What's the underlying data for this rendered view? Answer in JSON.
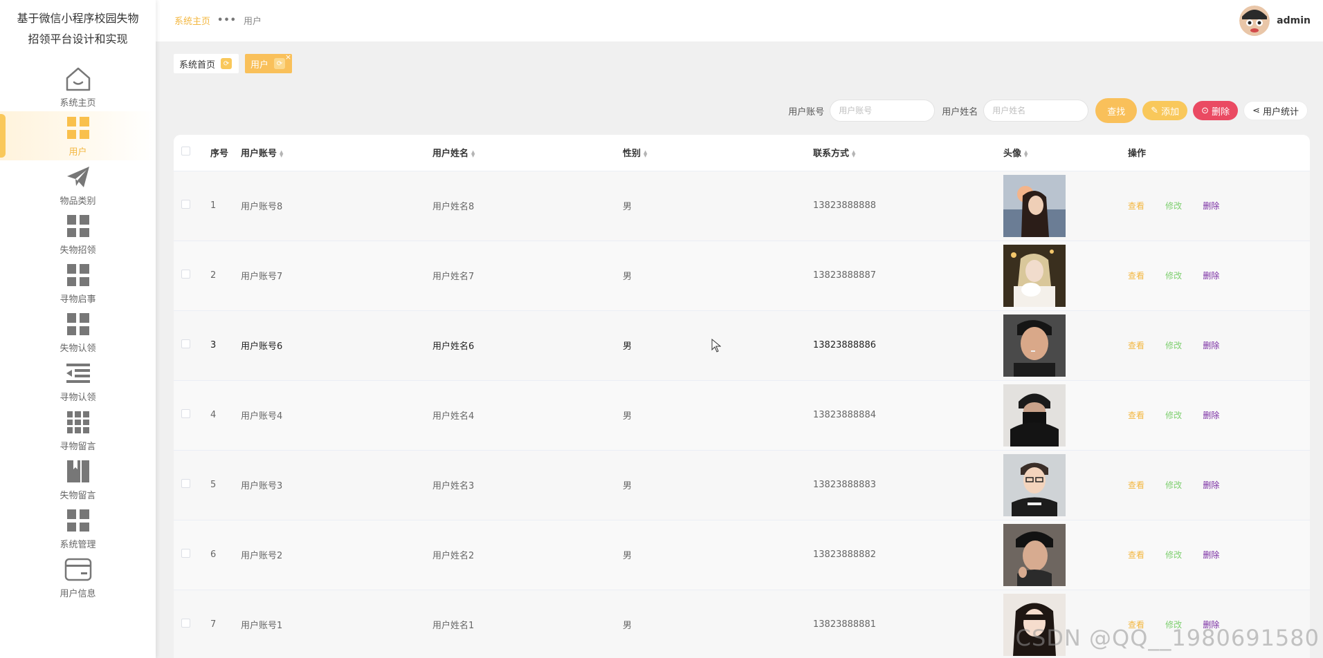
{
  "app": {
    "title_line1": "基于微信小程序校园失物",
    "title_line2": "招领平台设计和实现"
  },
  "sidebar": {
    "items": [
      {
        "label": "系统主页",
        "icon": "home-icon"
      },
      {
        "label": "用户",
        "icon": "grid-icon",
        "active": true
      },
      {
        "label": "物品类别",
        "icon": "paper-plane-icon"
      },
      {
        "label": "失物招领",
        "icon": "grid-icon"
      },
      {
        "label": "寻物启事",
        "icon": "grid-icon"
      },
      {
        "label": "失物认领",
        "icon": "grid-icon"
      },
      {
        "label": "寻物认领",
        "icon": "list-indent-icon"
      },
      {
        "label": "寻物留言",
        "icon": "grid9-icon"
      },
      {
        "label": "失物留言",
        "icon": "book-icon"
      },
      {
        "label": "系统管理",
        "icon": "grid-icon"
      },
      {
        "label": "用户信息",
        "icon": "card-icon"
      }
    ]
  },
  "header": {
    "breadcrumb_home": "系统主页",
    "breadcrumb_sep": "•••",
    "breadcrumb_current": "用户",
    "username": "admin"
  },
  "tags": {
    "home": "系统首页",
    "current": "用户",
    "close": "×"
  },
  "search": {
    "account_label": "用户账号",
    "account_placeholder": "用户账号",
    "name_label": "用户姓名",
    "name_placeholder": "用户姓名",
    "search_btn": "查找",
    "add_btn": "添加",
    "delete_btn": "删除",
    "stats_btn": "用户统计"
  },
  "table": {
    "headers": {
      "index": "序号",
      "account": "用户账号",
      "name": "用户姓名",
      "gender": "性别",
      "phone": "联系方式",
      "avatar": "头像",
      "actions": "操作"
    },
    "action_labels": {
      "view": "查看",
      "edit": "修改",
      "delete": "删除"
    },
    "rows": [
      {
        "index": "1",
        "account": "用户账号8",
        "name": "用户姓名8",
        "gender": "男",
        "phone": "13823888888"
      },
      {
        "index": "2",
        "account": "用户账号7",
        "name": "用户姓名7",
        "gender": "男",
        "phone": "13823888887"
      },
      {
        "index": "3",
        "account": "用户账号6",
        "name": "用户姓名6",
        "gender": "男",
        "phone": "13823888886"
      },
      {
        "index": "4",
        "account": "用户账号4",
        "name": "用户姓名4",
        "gender": "男",
        "phone": "13823888884"
      },
      {
        "index": "5",
        "account": "用户账号3",
        "name": "用户姓名3",
        "gender": "男",
        "phone": "13823888883"
      },
      {
        "index": "6",
        "account": "用户账号2",
        "name": "用户姓名2",
        "gender": "男",
        "phone": "13823888882"
      },
      {
        "index": "7",
        "account": "用户账号1",
        "name": "用户姓名1",
        "gender": "男",
        "phone": "13823888881"
      }
    ]
  },
  "watermark": "CSDN @QQ__1980691580",
  "colors": {
    "accent": "#f9c05a",
    "danger": "#ea4a62",
    "edit": "#7ecf6f",
    "delete_link": "#7a2ea3"
  }
}
